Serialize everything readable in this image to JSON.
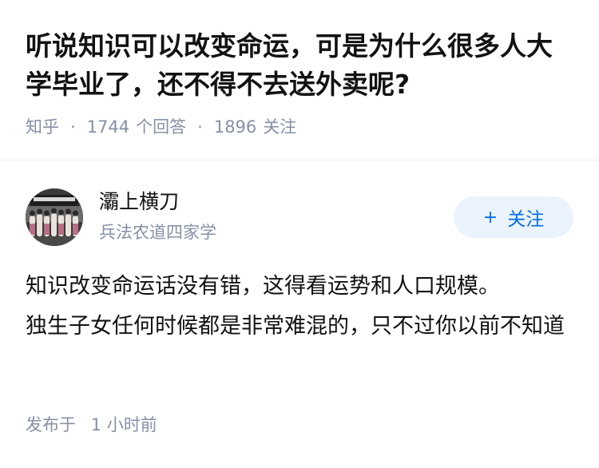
{
  "question": {
    "title": "听说知识可以改变命运，可是为什么很多人大学毕业了，还不得不去送外卖呢?",
    "source": "知乎",
    "answers_count": "1744",
    "answers_label": "个回答",
    "followers_count": "1896",
    "followers_label": "关注"
  },
  "author": {
    "name": "灞上横刀",
    "bio": "兵法农道四家学",
    "avatar_icon": "group-photo-avatar",
    "follow_label": "关注",
    "follow_icon": "plus-icon",
    "follow_color": "#056de8",
    "follow_bg": "#ebf3fc"
  },
  "answer": {
    "content": "知识改变命运话没有错，这得看运势和人口规模。\n独生子女任何时候都是非常难混的，只不过你以前不知道",
    "posted_label": "发布于",
    "posted_time": "1 小时前"
  }
}
